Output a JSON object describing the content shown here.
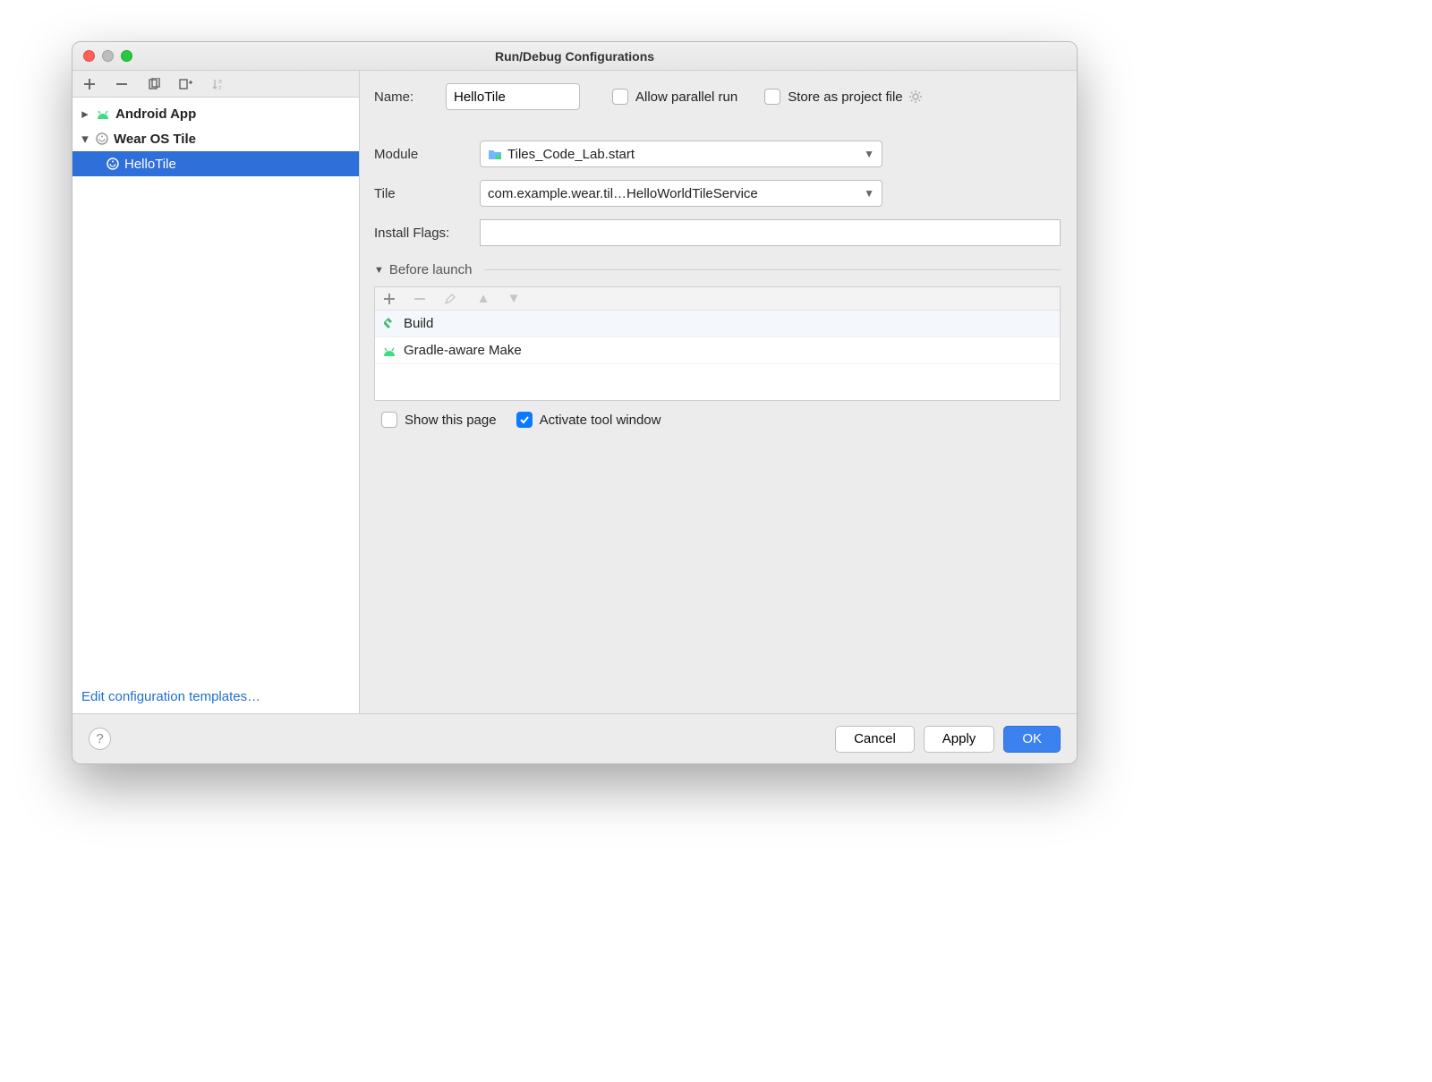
{
  "window": {
    "title": "Run/Debug Configurations"
  },
  "sidebar": {
    "groups": [
      {
        "label": "Android App",
        "expanded": false
      },
      {
        "label": "Wear OS Tile",
        "expanded": true
      }
    ],
    "selected_item": "HelloTile",
    "footer_link": "Edit configuration templates…"
  },
  "form": {
    "name_label": "Name:",
    "name_value": "HelloTile",
    "allow_parallel_label": "Allow parallel run",
    "allow_parallel_checked": false,
    "store_project_label": "Store as project file",
    "store_project_checked": false,
    "module_label": "Module",
    "module_value": "Tiles_Code_Lab.start",
    "tile_label": "Tile",
    "tile_value": "com.example.wear.til…HelloWorldTileService",
    "install_flags_label": "Install Flags:",
    "install_flags_value": ""
  },
  "before_launch": {
    "title": "Before launch",
    "items": [
      {
        "icon": "hammer",
        "label": "Build"
      },
      {
        "icon": "android",
        "label": "Gradle-aware Make"
      }
    ],
    "show_this_page_label": "Show this page",
    "show_this_page_checked": false,
    "activate_tool_label": "Activate tool window",
    "activate_tool_checked": true
  },
  "footer": {
    "cancel": "Cancel",
    "apply": "Apply",
    "ok": "OK"
  }
}
